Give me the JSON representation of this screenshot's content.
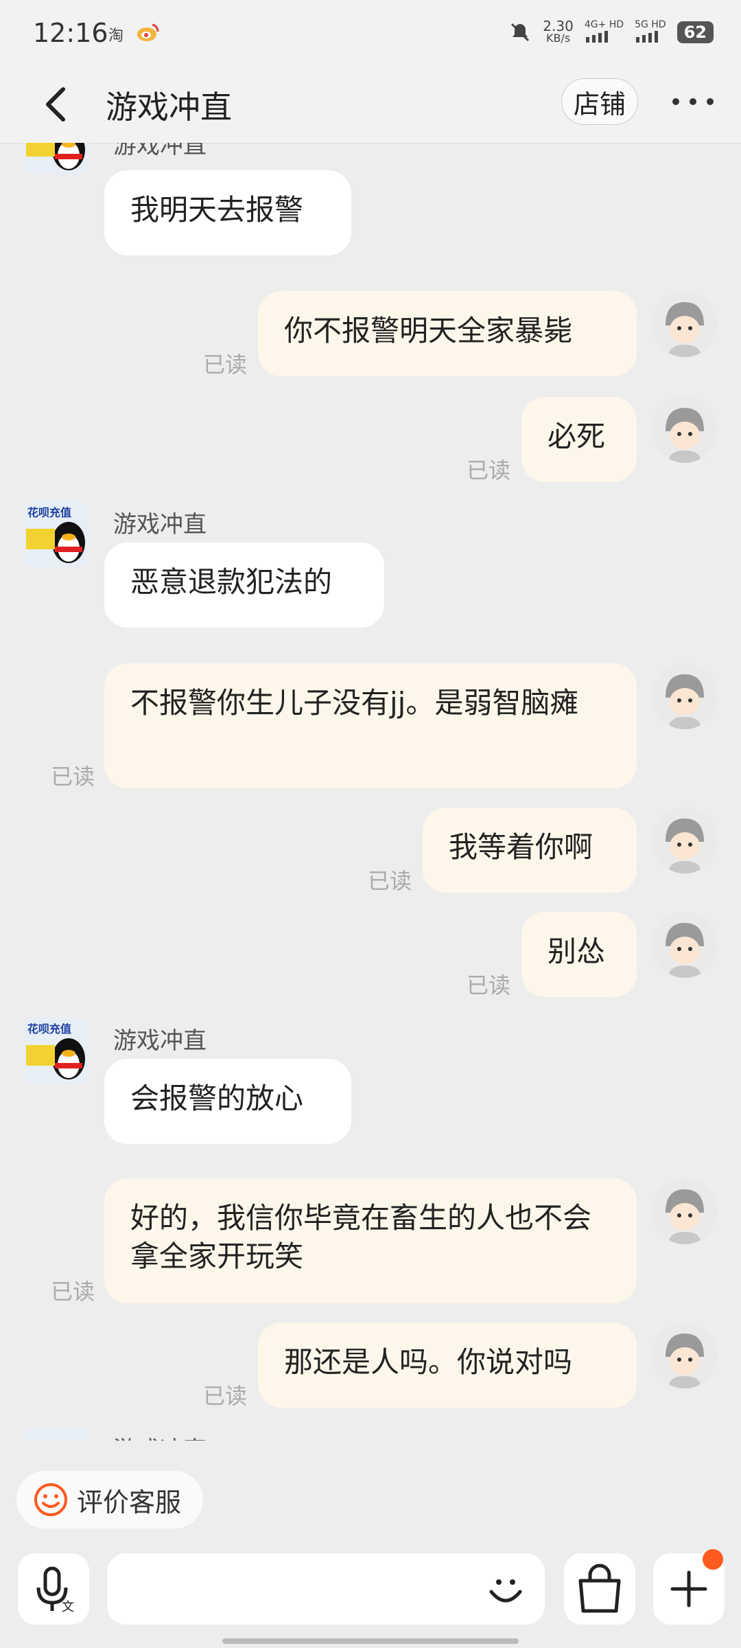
{
  "status_bar": {
    "time": "12:16",
    "app_icon_1": "淘",
    "network_speed_value": "2.30",
    "network_speed_unit": "KB/s",
    "sim1": "4G+ HD",
    "sim2": "5G HD",
    "battery": "62"
  },
  "header": {
    "title": "游戏冲直",
    "shop_button": "店铺"
  },
  "messages": [
    {
      "side": "left",
      "sender": "游戏冲直",
      "text": "我明天去报警"
    },
    {
      "side": "right",
      "text": "你不报警明天全家暴毙",
      "read": "已读"
    },
    {
      "side": "right",
      "text": "必死",
      "read": "已读"
    },
    {
      "side": "left",
      "sender": "游戏冲直",
      "text": "恶意退款犯法的"
    },
    {
      "side": "right",
      "text": "不报警你生儿子没有jj。是弱智脑瘫",
      "read": "已读"
    },
    {
      "side": "right",
      "text": "我等着你啊",
      "read": "已读"
    },
    {
      "side": "right",
      "text": "别怂",
      "read": "已读"
    },
    {
      "side": "left",
      "sender": "游戏冲直",
      "text": "会报警的放心"
    },
    {
      "side": "right",
      "text": "好的，我信你毕竟在畜生的人也不会拿全家开玩笑",
      "read": "已读"
    },
    {
      "side": "right",
      "text": "那还是人吗。你说对吗",
      "read": "已读"
    },
    {
      "side": "left",
      "sender": "游戏冲直",
      "text": ""
    }
  ],
  "shop_avatar_text": "花呗充值",
  "rate_button": "评价客服",
  "colors": {
    "accent": "#ff5a1f",
    "bubble_right": "#fdf7eb",
    "bubble_left": "#ffffff",
    "background": "#ededed"
  }
}
